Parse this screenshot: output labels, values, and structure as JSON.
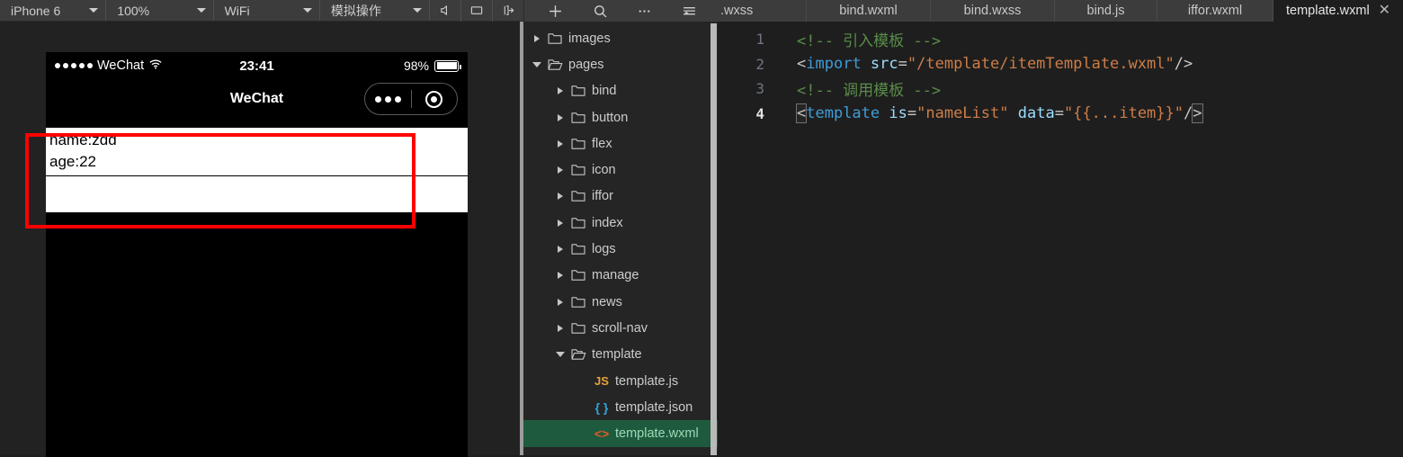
{
  "simulator_toolbar": {
    "device": "iPhone 6",
    "zoom": "100%",
    "network": "WiFi",
    "simulate": "模拟操作",
    "icons": [
      "volume-icon",
      "screen-rotate-icon",
      "send-to-device-icon"
    ]
  },
  "editor_toolbar": {
    "icons": [
      "add-icon",
      "search-icon",
      "more-icon",
      "outline-icon"
    ]
  },
  "tabs": [
    {
      "label": ".wxss",
      "name": "tab-wxss",
      "active": false,
      "clipped": true,
      "width": "tab-w1"
    },
    {
      "label": "bind.wxml",
      "name": "tab-bind-wxml",
      "active": false,
      "clipped": false,
      "width": "tab-w2"
    },
    {
      "label": "bind.wxss",
      "name": "tab-bind-wxss",
      "active": false,
      "clipped": false,
      "width": "tab-w2"
    },
    {
      "label": "bind.js",
      "name": "tab-bind-js",
      "active": false,
      "clipped": false,
      "width": "tab-w3"
    },
    {
      "label": "iffor.wxml",
      "name": "tab-iffor-wxml",
      "active": false,
      "clipped": false,
      "width": "tab-w4"
    },
    {
      "label": "template.wxml",
      "name": "tab-template-wxml",
      "active": true,
      "clipped": false,
      "width": ""
    }
  ],
  "tab_close_glyph": "✕",
  "phone": {
    "carrier": "WeChat",
    "time": "23:41",
    "battery_percent": "98%",
    "nav_title": "WeChat",
    "capsule": {
      "more": "more-icon",
      "target": "target-icon"
    },
    "items": [
      {
        "lines": [
          "name:zdd",
          "age:22"
        ]
      },
      {
        "lines": []
      }
    ]
  },
  "file_tree": [
    {
      "label": "images",
      "type": "folder",
      "state": "collapsed",
      "indent": 0,
      "selected": false
    },
    {
      "label": "pages",
      "type": "folder",
      "state": "expanded",
      "indent": 0,
      "selected": false
    },
    {
      "label": "bind",
      "type": "folder",
      "state": "collapsed",
      "indent": 1,
      "selected": false
    },
    {
      "label": "button",
      "type": "folder",
      "state": "collapsed",
      "indent": 1,
      "selected": false
    },
    {
      "label": "flex",
      "type": "folder",
      "state": "collapsed",
      "indent": 1,
      "selected": false
    },
    {
      "label": "icon",
      "type": "folder",
      "state": "collapsed",
      "indent": 1,
      "selected": false
    },
    {
      "label": "iffor",
      "type": "folder",
      "state": "collapsed",
      "indent": 1,
      "selected": false
    },
    {
      "label": "index",
      "type": "folder",
      "state": "collapsed",
      "indent": 1,
      "selected": false
    },
    {
      "label": "logs",
      "type": "folder",
      "state": "collapsed",
      "indent": 1,
      "selected": false
    },
    {
      "label": "manage",
      "type": "folder",
      "state": "collapsed",
      "indent": 1,
      "selected": false
    },
    {
      "label": "news",
      "type": "folder",
      "state": "collapsed",
      "indent": 1,
      "selected": false
    },
    {
      "label": "scroll-nav",
      "type": "folder",
      "state": "collapsed",
      "indent": 1,
      "selected": false
    },
    {
      "label": "template",
      "type": "folder",
      "state": "expanded",
      "indent": 1,
      "selected": false
    },
    {
      "label": "template.js",
      "type": "file",
      "badge": "JS",
      "badge_class": "ft-js",
      "indent": 2,
      "selected": false
    },
    {
      "label": "template.json",
      "type": "file",
      "badge": "{ }",
      "badge_class": "ft-json",
      "indent": 2,
      "selected": false
    },
    {
      "label": "template.wxml",
      "type": "file",
      "badge": "<>",
      "badge_class": "ft-wxml",
      "indent": 2,
      "selected": true
    }
  ],
  "code": [
    {
      "num": "1",
      "current": false,
      "tokens": [
        {
          "t": "<!-- 引入模板 -->",
          "c": "tok-comment"
        }
      ]
    },
    {
      "num": "2",
      "current": false,
      "tokens": [
        {
          "t": "<",
          "c": "tok-punc"
        },
        {
          "t": "import",
          "c": "tok-tag"
        },
        {
          "t": " ",
          "c": "tok-punc"
        },
        {
          "t": "src",
          "c": "tok-attr"
        },
        {
          "t": "=",
          "c": "tok-eq"
        },
        {
          "t": "\"/template/itemTemplate.wxml\"",
          "c": "tok-str"
        },
        {
          "t": "/>",
          "c": "tok-punc"
        }
      ]
    },
    {
      "num": "3",
      "current": false,
      "tokens": [
        {
          "t": "<!-- 调用模板 -->",
          "c": "tok-comment"
        }
      ]
    },
    {
      "num": "4",
      "current": true,
      "tokens": [
        {
          "t": "<",
          "c": "tok-punc bracket-hl"
        },
        {
          "t": "template",
          "c": "tok-tag"
        },
        {
          "t": " ",
          "c": "tok-punc"
        },
        {
          "t": "is",
          "c": "tok-attr"
        },
        {
          "t": "=",
          "c": "tok-eq"
        },
        {
          "t": "\"nameList\"",
          "c": "tok-str"
        },
        {
          "t": " ",
          "c": "tok-punc"
        },
        {
          "t": "data",
          "c": "tok-attr"
        },
        {
          "t": "=",
          "c": "tok-eq"
        },
        {
          "t": "\"{{...item}}\"",
          "c": "tok-str"
        },
        {
          "t": "/",
          "c": "tok-punc"
        },
        {
          "t": ">",
          "c": "tok-punc bracket-hl"
        }
      ]
    }
  ],
  "colors": {
    "chrome": "#3c3c3c",
    "editor_bg": "#1e1e1e",
    "tree_bg": "#252525",
    "selection_green": "#1e5b3e",
    "annotation_red": "#ff0000",
    "simulator_bg": "#222222"
  }
}
